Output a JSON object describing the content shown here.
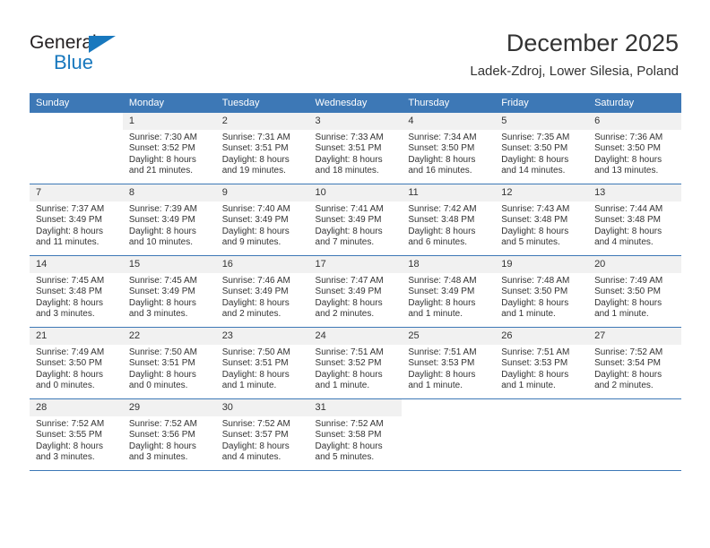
{
  "brand": {
    "name_top": "General",
    "name_bottom": "Blue",
    "triangle_color": "#1878be"
  },
  "header": {
    "title": "December 2025",
    "subtitle": "Ladek-Zdroj, Lower Silesia, Poland",
    "accent_color": "#3d78b6",
    "daynum_band_color": "#f1f1f1"
  },
  "calendar": {
    "weekday_headers": [
      "Sunday",
      "Monday",
      "Tuesday",
      "Wednesday",
      "Thursday",
      "Friday",
      "Saturday"
    ],
    "weeks": [
      [
        {
          "day": "",
          "blank": true,
          "lines": []
        },
        {
          "day": "1",
          "lines": [
            "Sunrise: 7:30 AM",
            "Sunset: 3:52 PM",
            "Daylight: 8 hours",
            "and 21 minutes."
          ]
        },
        {
          "day": "2",
          "lines": [
            "Sunrise: 7:31 AM",
            "Sunset: 3:51 PM",
            "Daylight: 8 hours",
            "and 19 minutes."
          ]
        },
        {
          "day": "3",
          "lines": [
            "Sunrise: 7:33 AM",
            "Sunset: 3:51 PM",
            "Daylight: 8 hours",
            "and 18 minutes."
          ]
        },
        {
          "day": "4",
          "lines": [
            "Sunrise: 7:34 AM",
            "Sunset: 3:50 PM",
            "Daylight: 8 hours",
            "and 16 minutes."
          ]
        },
        {
          "day": "5",
          "lines": [
            "Sunrise: 7:35 AM",
            "Sunset: 3:50 PM",
            "Daylight: 8 hours",
            "and 14 minutes."
          ]
        },
        {
          "day": "6",
          "lines": [
            "Sunrise: 7:36 AM",
            "Sunset: 3:50 PM",
            "Daylight: 8 hours",
            "and 13 minutes."
          ]
        }
      ],
      [
        {
          "day": "7",
          "lines": [
            "Sunrise: 7:37 AM",
            "Sunset: 3:49 PM",
            "Daylight: 8 hours",
            "and 11 minutes."
          ]
        },
        {
          "day": "8",
          "lines": [
            "Sunrise: 7:39 AM",
            "Sunset: 3:49 PM",
            "Daylight: 8 hours",
            "and 10 minutes."
          ]
        },
        {
          "day": "9",
          "lines": [
            "Sunrise: 7:40 AM",
            "Sunset: 3:49 PM",
            "Daylight: 8 hours",
            "and 9 minutes."
          ]
        },
        {
          "day": "10",
          "lines": [
            "Sunrise: 7:41 AM",
            "Sunset: 3:49 PM",
            "Daylight: 8 hours",
            "and 7 minutes."
          ]
        },
        {
          "day": "11",
          "lines": [
            "Sunrise: 7:42 AM",
            "Sunset: 3:48 PM",
            "Daylight: 8 hours",
            "and 6 minutes."
          ]
        },
        {
          "day": "12",
          "lines": [
            "Sunrise: 7:43 AM",
            "Sunset: 3:48 PM",
            "Daylight: 8 hours",
            "and 5 minutes."
          ]
        },
        {
          "day": "13",
          "lines": [
            "Sunrise: 7:44 AM",
            "Sunset: 3:48 PM",
            "Daylight: 8 hours",
            "and 4 minutes."
          ]
        }
      ],
      [
        {
          "day": "14",
          "lines": [
            "Sunrise: 7:45 AM",
            "Sunset: 3:48 PM",
            "Daylight: 8 hours",
            "and 3 minutes."
          ]
        },
        {
          "day": "15",
          "lines": [
            "Sunrise: 7:45 AM",
            "Sunset: 3:49 PM",
            "Daylight: 8 hours",
            "and 3 minutes."
          ]
        },
        {
          "day": "16",
          "lines": [
            "Sunrise: 7:46 AM",
            "Sunset: 3:49 PM",
            "Daylight: 8 hours",
            "and 2 minutes."
          ]
        },
        {
          "day": "17",
          "lines": [
            "Sunrise: 7:47 AM",
            "Sunset: 3:49 PM",
            "Daylight: 8 hours",
            "and 2 minutes."
          ]
        },
        {
          "day": "18",
          "lines": [
            "Sunrise: 7:48 AM",
            "Sunset: 3:49 PM",
            "Daylight: 8 hours",
            "and 1 minute."
          ]
        },
        {
          "day": "19",
          "lines": [
            "Sunrise: 7:48 AM",
            "Sunset: 3:50 PM",
            "Daylight: 8 hours",
            "and 1 minute."
          ]
        },
        {
          "day": "20",
          "lines": [
            "Sunrise: 7:49 AM",
            "Sunset: 3:50 PM",
            "Daylight: 8 hours",
            "and 1 minute."
          ]
        }
      ],
      [
        {
          "day": "21",
          "lines": [
            "Sunrise: 7:49 AM",
            "Sunset: 3:50 PM",
            "Daylight: 8 hours",
            "and 0 minutes."
          ]
        },
        {
          "day": "22",
          "lines": [
            "Sunrise: 7:50 AM",
            "Sunset: 3:51 PM",
            "Daylight: 8 hours",
            "and 0 minutes."
          ]
        },
        {
          "day": "23",
          "lines": [
            "Sunrise: 7:50 AM",
            "Sunset: 3:51 PM",
            "Daylight: 8 hours",
            "and 1 minute."
          ]
        },
        {
          "day": "24",
          "lines": [
            "Sunrise: 7:51 AM",
            "Sunset: 3:52 PM",
            "Daylight: 8 hours",
            "and 1 minute."
          ]
        },
        {
          "day": "25",
          "lines": [
            "Sunrise: 7:51 AM",
            "Sunset: 3:53 PM",
            "Daylight: 8 hours",
            "and 1 minute."
          ]
        },
        {
          "day": "26",
          "lines": [
            "Sunrise: 7:51 AM",
            "Sunset: 3:53 PM",
            "Daylight: 8 hours",
            "and 1 minute."
          ]
        },
        {
          "day": "27",
          "lines": [
            "Sunrise: 7:52 AM",
            "Sunset: 3:54 PM",
            "Daylight: 8 hours",
            "and 2 minutes."
          ]
        }
      ],
      [
        {
          "day": "28",
          "lines": [
            "Sunrise: 7:52 AM",
            "Sunset: 3:55 PM",
            "Daylight: 8 hours",
            "and 3 minutes."
          ]
        },
        {
          "day": "29",
          "lines": [
            "Sunrise: 7:52 AM",
            "Sunset: 3:56 PM",
            "Daylight: 8 hours",
            "and 3 minutes."
          ]
        },
        {
          "day": "30",
          "lines": [
            "Sunrise: 7:52 AM",
            "Sunset: 3:57 PM",
            "Daylight: 8 hours",
            "and 4 minutes."
          ]
        },
        {
          "day": "31",
          "lines": [
            "Sunrise: 7:52 AM",
            "Sunset: 3:58 PM",
            "Daylight: 8 hours",
            "and 5 minutes."
          ]
        },
        {
          "day": "",
          "blank": true,
          "lines": []
        },
        {
          "day": "",
          "blank": true,
          "lines": []
        },
        {
          "day": "",
          "blank": true,
          "lines": []
        }
      ]
    ]
  }
}
